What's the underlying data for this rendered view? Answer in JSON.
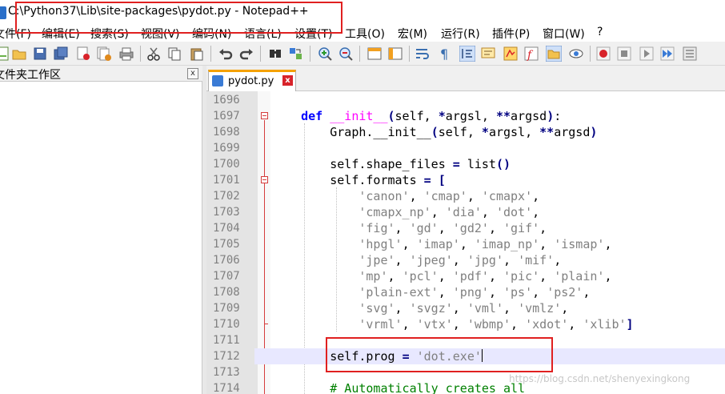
{
  "window": {
    "title": "C:\\Python37\\Lib\\site-packages\\pydot.py - Notepad++"
  },
  "menu": [
    {
      "label": "文件(F)"
    },
    {
      "label": "编辑(E)"
    },
    {
      "label": "搜索(S)"
    },
    {
      "label": "视图(V)"
    },
    {
      "label": "编码(N)"
    },
    {
      "label": "语言(L)"
    },
    {
      "label": "设置(T)"
    },
    {
      "label": "工具(O)"
    },
    {
      "label": "宏(M)"
    },
    {
      "label": "运行(R)"
    },
    {
      "label": "插件(P)"
    },
    {
      "label": "窗口(W)"
    },
    {
      "label": "?"
    }
  ],
  "toolbar_icons": [
    "new-file-icon",
    "open-file-icon",
    "save-icon",
    "save-all-icon",
    "close-icon",
    "close-all-icon",
    "print-icon",
    "cut-icon",
    "copy-icon",
    "paste-icon",
    "undo-icon",
    "redo-icon",
    "find-icon",
    "replace-icon",
    "zoom-in-icon",
    "zoom-out-icon",
    "sync-vertical-icon",
    "sync-horizontal-icon",
    "word-wrap-icon",
    "show-all-chars-icon",
    "indent-guide-icon",
    "user-language-icon",
    "doc-map-icon",
    "function-list-icon",
    "folder-workspace-icon",
    "monitoring-icon",
    "record-macro-icon",
    "stop-macro-icon",
    "play-macro-icon",
    "run-macro-multiple-icon",
    "save-macro-icon"
  ],
  "panel": {
    "title": "文件夹工作区",
    "close": "x"
  },
  "tab": {
    "label": "pydot.py",
    "close": "x"
  },
  "editor": {
    "lines": [
      {
        "n": "1696",
        "code": ""
      },
      {
        "n": "1697",
        "code": "    def __init__(self, *argsl, **argsd):"
      },
      {
        "n": "1698",
        "code": "        Graph.__init__(self, *argsl, **argsd)"
      },
      {
        "n": "1699",
        "code": ""
      },
      {
        "n": "1700",
        "code": "        self.shape_files = list()"
      },
      {
        "n": "1701",
        "code": "        self.formats = ["
      },
      {
        "n": "1702",
        "code": "            'canon', 'cmap', 'cmapx',"
      },
      {
        "n": "1703",
        "code": "            'cmapx_np', 'dia', 'dot',"
      },
      {
        "n": "1704",
        "code": "            'fig', 'gd', 'gd2', 'gif',"
      },
      {
        "n": "1705",
        "code": "            'hpgl', 'imap', 'imap_np', 'ismap',"
      },
      {
        "n": "1706",
        "code": "            'jpe', 'jpeg', 'jpg', 'mif',"
      },
      {
        "n": "1707",
        "code": "            'mp', 'pcl', 'pdf', 'pic', 'plain',"
      },
      {
        "n": "1708",
        "code": "            'plain-ext', 'png', 'ps', 'ps2',"
      },
      {
        "n": "1709",
        "code": "            'svg', 'svgz', 'vml', 'vmlz',"
      },
      {
        "n": "1710",
        "code": "            'vrml', 'vtx', 'wbmp', 'xdot', 'xlib']"
      },
      {
        "n": "1711",
        "code": ""
      },
      {
        "n": "1712",
        "code": "        self.prog = 'dot.exe'"
      },
      {
        "n": "1713",
        "code": ""
      },
      {
        "n": "1714",
        "code": "        # Automatically creates all"
      }
    ],
    "current_line": "1712"
  },
  "watermark": "https://blog.csdn.net/shenyexingkong",
  "colors": {
    "annotation_red": "#e02020",
    "keyword": "#0000ff",
    "function_name": "#ff00ff",
    "string": "#808080",
    "comment": "#008000",
    "fold_marker": "#d53c3c",
    "current_line_bg": "#e8e8ff"
  }
}
